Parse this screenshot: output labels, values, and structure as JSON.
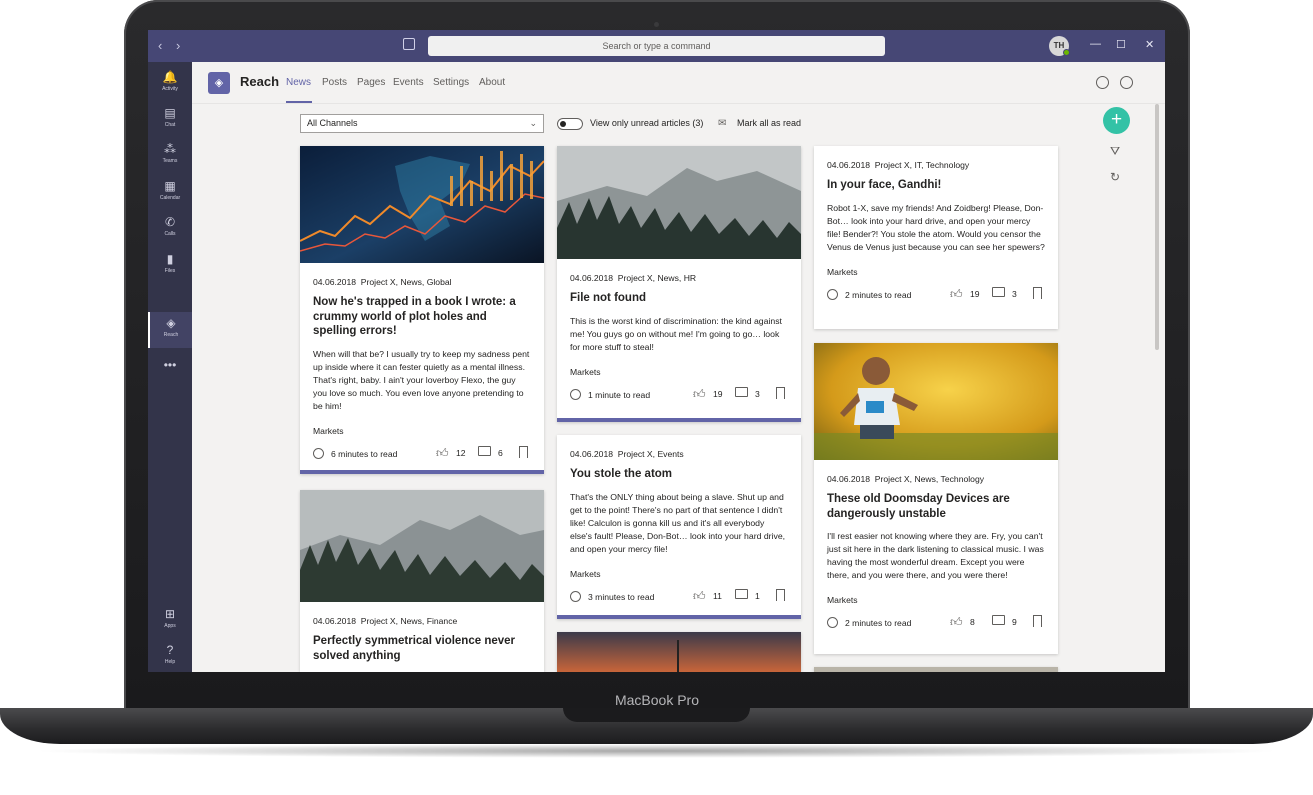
{
  "device": {
    "brand_label": "MacBook Pro"
  },
  "titlebar": {
    "search_placeholder": "Search or type a command",
    "avatar_initials": "TH",
    "back_icon": "chevron-left-icon",
    "forward_icon": "chevron-right-icon",
    "compose_icon": "compose-icon",
    "min": "—",
    "max": "☐",
    "close": "✕"
  },
  "rail": {
    "items": [
      {
        "label": "Activity",
        "glyph": "🔔"
      },
      {
        "label": "Chat",
        "glyph": "▤"
      },
      {
        "label": "Teams",
        "glyph": "⁂"
      },
      {
        "label": "Calendar",
        "glyph": "▦"
      },
      {
        "label": "Calls",
        "glyph": "✆"
      },
      {
        "label": "Files",
        "glyph": "▮"
      },
      {
        "label": "Reach",
        "glyph": "◈"
      },
      {
        "label": "",
        "glyph": "•••"
      }
    ],
    "bottom": [
      {
        "label": "Apps",
        "glyph": "⊞"
      },
      {
        "label": "Help",
        "glyph": "?"
      }
    ]
  },
  "app": {
    "logo_glyph": "◈",
    "name": "Reach",
    "tabs": [
      "News",
      "Posts",
      "Pages",
      "Events",
      "Settings",
      "About"
    ],
    "active_tab": "News"
  },
  "filters": {
    "channel_select": "All Channels",
    "chevron": "⌄",
    "unread_toggle_label": "View only unread articles (3)",
    "mark_icon": "✉",
    "mark_all_label": "Mark all as read"
  },
  "side_actions": {
    "add": "+",
    "filter": "⛛",
    "refresh": "↻"
  },
  "articles": [
    {
      "date": "04.06.2018",
      "channels": "Project X, News, Global",
      "title": "Now he's trapped in a book I wrote: a crummy world of plot holes and spelling errors!",
      "excerpt": "When will that be? I usually try to keep my sadness pent up inside where it can fester quietly as a mental illness. That's right, baby. I ain't your loverboy Flexo, the guy you love so much. You even love anyone pretending to be him!",
      "tag": "Markets",
      "read_time": "6 minutes to read",
      "likes": "12",
      "comments": "6",
      "image": "financial-chart"
    },
    {
      "date": "04.06.2018",
      "channels": "Project X, News, Finance",
      "title": "Perfectly symmetrical violence never solved anything",
      "image": "misty-forest"
    },
    {
      "date": "04.06.2018",
      "channels": "Project X, News, HR",
      "title": "File not found",
      "excerpt": "This is the worst kind of discrimination: the kind against me! You guys go on without me! I'm going to go… look for more stuff to steal!",
      "tag": "Markets",
      "read_time": "1 minute to read",
      "likes": "19",
      "comments": "3",
      "image": "misty-forest"
    },
    {
      "date": "04.06.2018",
      "channels": "Project X, Events",
      "title": "You stole the atom",
      "excerpt": "That's the ONLY thing about being a slave. Shut up and get to the point! There's no part of that sentence I didn't like! Calculon is gonna kill us and it's all everybody else's fault! Please, Don-Bot… look into your hard drive, and open your mercy file!",
      "tag": "Markets",
      "read_time": "3 minutes to read",
      "likes": "11",
      "comments": "1"
    },
    {
      "date": "04.06.2018",
      "channels": "Project X, IT, Technology",
      "title": "In your face, Gandhi!",
      "excerpt": "Robot 1-X, save my friends! And Zoidberg! Please, Don-Bot… look into your hard drive, and open your mercy file! Bender?! You stole the atom. Would you censor the Venus de Venus just because you can see her spewers?",
      "tag": "Markets",
      "read_time": "2 minutes to read",
      "likes": "19",
      "comments": "3"
    },
    {
      "date": "04.06.2018",
      "channels": "Project X, News, Technology",
      "title": "These old Doomsday Devices are dangerously unstable",
      "excerpt": "I'll rest easier not knowing where they are. Fry, you can't just sit here in the dark listening to classical music. I was having the most wonderful dream. Except you were there, and you were there, and you were there!",
      "tag": "Markets",
      "read_time": "2 minutes to read",
      "likes": "8",
      "comments": "9",
      "image": "child-sprinkler"
    }
  ]
}
